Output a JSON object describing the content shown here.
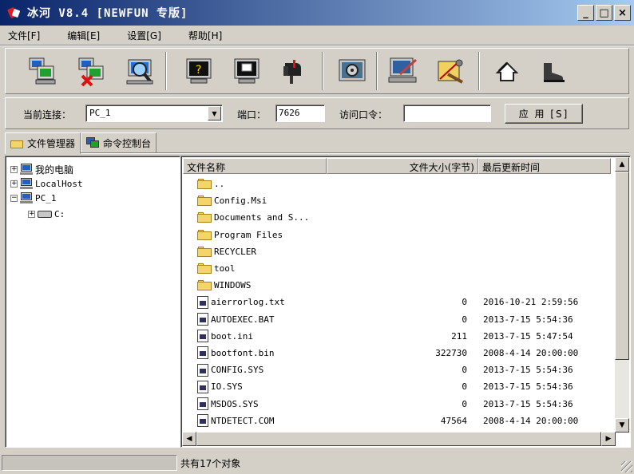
{
  "window": {
    "title": "冰河 V8.4 [NEWFUN 专版]",
    "controls": {
      "minimize": "_",
      "maximize": "□",
      "close": "×"
    }
  },
  "menu": [
    {
      "label": "文件[F]"
    },
    {
      "label": "编辑[E]"
    },
    {
      "label": "设置[G]"
    },
    {
      "label": "帮助[H]"
    }
  ],
  "toolbar": {
    "icons": [
      "add-host-icon",
      "delete-host-icon",
      "search-host-icon",
      "help-icon",
      "screen-capture-icon",
      "mailbox-icon",
      "config-icon",
      "settings-icon",
      "tools-icon",
      "home-icon",
      "exit-icon"
    ]
  },
  "connection": {
    "current_label": "当前连接：",
    "current_value": "PC_1",
    "port_label": "端口：",
    "port_value": "7626",
    "password_label": "访问口令：",
    "password_value": "",
    "apply_label": "应 用 [S]"
  },
  "tabs": [
    {
      "label": "文件管理器",
      "active": true
    },
    {
      "label": "命令控制台",
      "active": false
    }
  ],
  "tree": [
    {
      "label": "我的电脑",
      "expander": "+"
    },
    {
      "label": "LocalHost",
      "expander": "+"
    },
    {
      "label": "PC_1",
      "expander": "−"
    },
    {
      "label": "C:",
      "expander": "+"
    }
  ],
  "filelist": {
    "columns": {
      "name": "文件名称",
      "size": "文件大小(字节)",
      "time": "最后更新时间"
    },
    "rows": [
      {
        "type": "folder",
        "name": "..",
        "size": "",
        "time": ""
      },
      {
        "type": "folder",
        "name": "Config.Msi",
        "size": "",
        "time": ""
      },
      {
        "type": "folder",
        "name": "Documents and S...",
        "size": "",
        "time": ""
      },
      {
        "type": "folder",
        "name": "Program Files",
        "size": "",
        "time": ""
      },
      {
        "type": "folder",
        "name": "RECYCLER",
        "size": "",
        "time": ""
      },
      {
        "type": "folder",
        "name": "tool",
        "size": "",
        "time": ""
      },
      {
        "type": "folder",
        "name": "WINDOWS",
        "size": "",
        "time": ""
      },
      {
        "type": "file",
        "name": "aierrorlog.txt",
        "size": "0",
        "time": "2016-10-21 2:59:56"
      },
      {
        "type": "file",
        "name": "AUTOEXEC.BAT",
        "size": "0",
        "time": "2013-7-15 5:54:36"
      },
      {
        "type": "file",
        "name": "boot.ini",
        "size": "211",
        "time": "2013-7-15 5:47:54"
      },
      {
        "type": "file",
        "name": "bootfont.bin",
        "size": "322730",
        "time": "2008-4-14 20:00:00"
      },
      {
        "type": "file",
        "name": "CONFIG.SYS",
        "size": "0",
        "time": "2013-7-15 5:54:36"
      },
      {
        "type": "file",
        "name": "IO.SYS",
        "size": "0",
        "time": "2013-7-15 5:54:36"
      },
      {
        "type": "file",
        "name": "MSDOS.SYS",
        "size": "0",
        "time": "2013-7-15 5:54:36"
      },
      {
        "type": "file",
        "name": "NTDETECT.COM",
        "size": "47564",
        "time": "2008-4-14 20:00:00"
      }
    ]
  },
  "status": {
    "text": "共有17个对象"
  }
}
